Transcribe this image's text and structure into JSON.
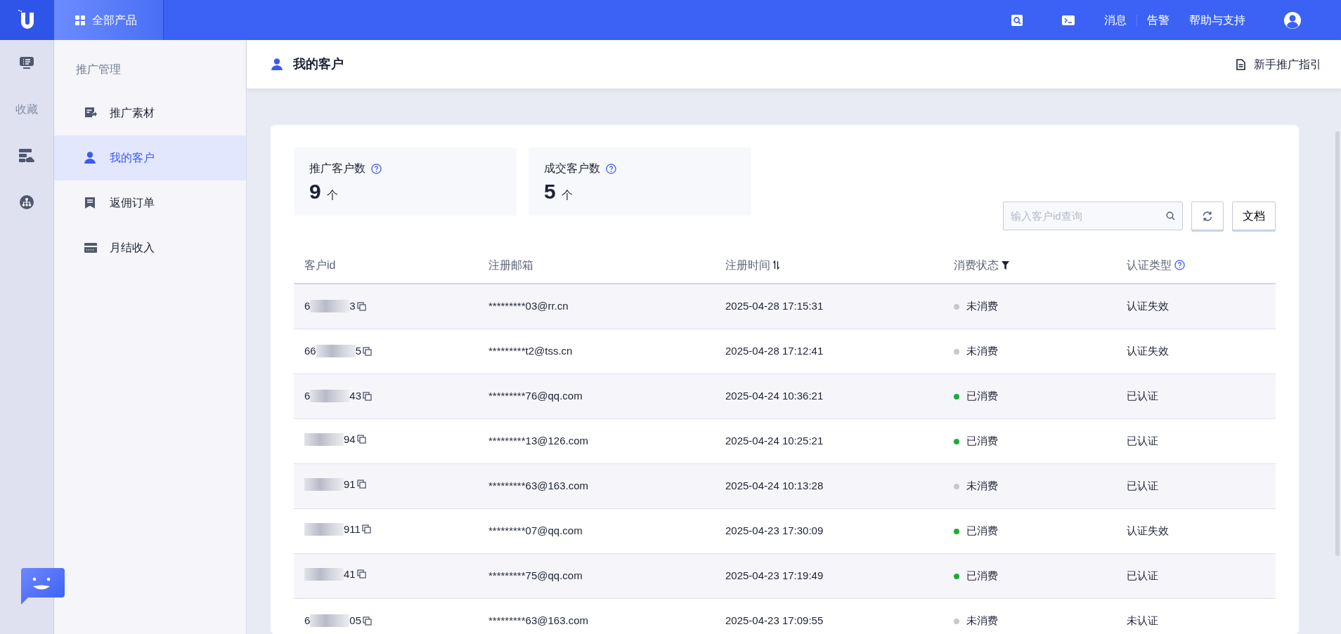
{
  "top_bar": {
    "products_label": "全部产品",
    "links": [
      "消息",
      "告警",
      "帮助与支持"
    ]
  },
  "rail": {
    "favorites_label": "收藏"
  },
  "sidebar": {
    "section": "推广管理",
    "items": [
      {
        "label": "推广素材",
        "selected": false
      },
      {
        "label": "我的客户",
        "selected": true
      },
      {
        "label": "返佣订单",
        "selected": false
      },
      {
        "label": "月结收入",
        "selected": false
      }
    ]
  },
  "header": {
    "title": "我的客户",
    "guide_link": "新手推广指引"
  },
  "stats": [
    {
      "label": "推广客户数",
      "value": "9",
      "unit": "个"
    },
    {
      "label": "成交客户数",
      "value": "5",
      "unit": "个"
    }
  ],
  "search": {
    "placeholder": "输入客户id查询"
  },
  "docs_button": "文档",
  "table": {
    "columns": [
      {
        "label": "客户id",
        "kind": "plain"
      },
      {
        "label": "注册邮箱",
        "kind": "plain"
      },
      {
        "label": "注册时间",
        "kind": "sort"
      },
      {
        "label": "消费状态",
        "kind": "filter"
      },
      {
        "label": "认证类型",
        "kind": "help"
      }
    ],
    "rows": [
      {
        "id_start": "6",
        "id_end": "3",
        "email": "*********03@rr.cn",
        "time": "2025-04-28 17:15:31",
        "status": "未消费",
        "color": "#c8c8cc",
        "auth": "认证失效"
      },
      {
        "id_start": "66",
        "id_end": "5",
        "email": "*********t2@tss.cn",
        "time": "2025-04-28 17:12:41",
        "status": "未消费",
        "color": "#c8c8cc",
        "auth": "认证失效"
      },
      {
        "id_start": "6",
        "id_end": "43",
        "email": "*********76@qq.com",
        "time": "2025-04-24 10:36:21",
        "status": "已消费",
        "color": "#1aad3a",
        "auth": "已认证"
      },
      {
        "id_end": "94",
        "email": "*********13@126.com",
        "time": "2025-04-24 10:25:21",
        "status": "已消费",
        "color": "#1aad3a",
        "auth": "已认证"
      },
      {
        "id_end": "91",
        "email": "*********63@163.com",
        "time": "2025-04-24 10:13:28",
        "status": "未消费",
        "color": "#c8c8cc",
        "auth": "已认证"
      },
      {
        "id_end": "911",
        "email": "*********07@qq.com",
        "time": "2025-04-23 17:30:09",
        "status": "已消费",
        "color": "#1aad3a",
        "auth": "认证失效"
      },
      {
        "id_end": "41",
        "email": "*********75@qq.com",
        "time": "2025-04-23 17:19:49",
        "status": "已消费",
        "color": "#1aad3a",
        "auth": "已认证"
      },
      {
        "id_start": "6",
        "id_end": "05",
        "email": "*********63@163.com",
        "time": "2025-04-23 17:09:55",
        "status": "未消费",
        "color": "#c8c8cc",
        "auth": "未认证"
      }
    ]
  }
}
